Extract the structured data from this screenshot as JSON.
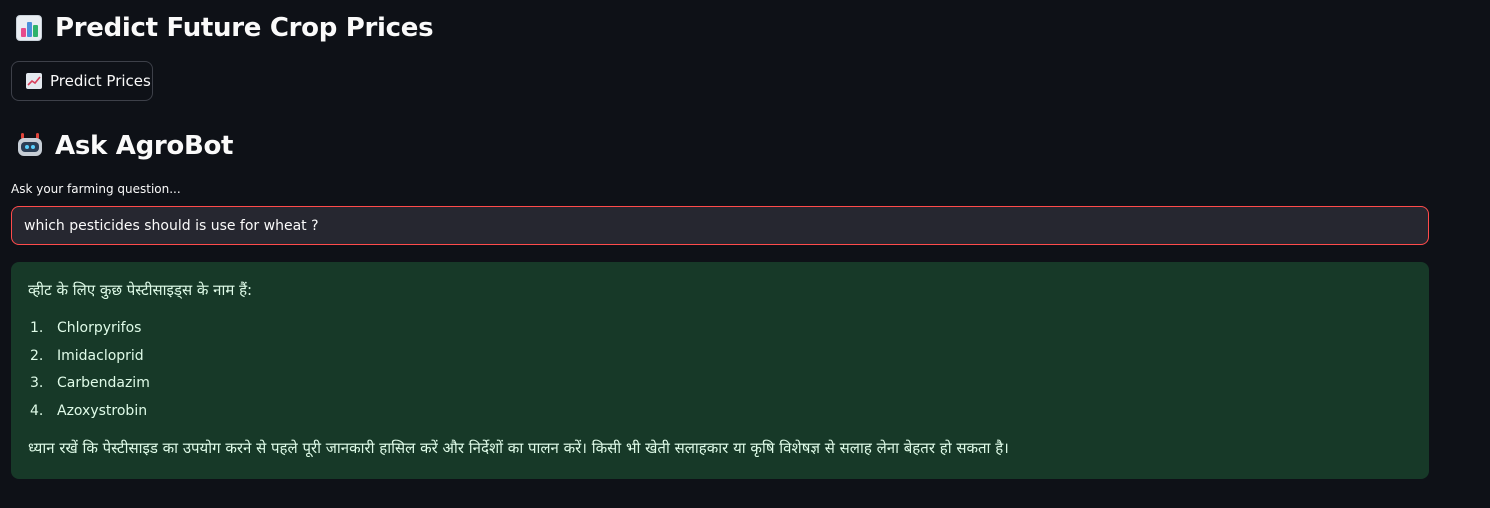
{
  "header": {
    "title": "Predict Future Crop Prices",
    "title_icon": "bar-chart-icon"
  },
  "actions": {
    "predict_button_label": "Predict Prices",
    "predict_button_icon": "chart-increasing-icon"
  },
  "chat": {
    "section_title": "Ask AgroBot",
    "section_icon": "robot-icon",
    "input_label": "Ask your farming question...",
    "input_value": "which pesticides should is use for wheat ?"
  },
  "answer": {
    "intro": "व्हीट के लिए कुछ पेस्टीसाइड्स के नाम हैं:",
    "items": [
      {
        "number": "1.",
        "label": "Chlorpyrifos"
      },
      {
        "number": "2.",
        "label": "Imidacloprid"
      },
      {
        "number": "3.",
        "label": "Carbendazim"
      },
      {
        "number": "4.",
        "label": "Azoxystrobin"
      }
    ],
    "outro": "ध्यान रखें कि पेस्टीसाइड का उपयोग करने से पहले पूरी जानकारी हासिल करें और निर्देशों का पालन करें। किसी भी खेती सलाहकार या कृषि विशेषज्ञ से सलाह लेना बेहतर हो सकता है।"
  },
  "colors": {
    "background": "#0e1117",
    "input_background": "#262730",
    "input_border_focus": "#ff4b4b",
    "success_background": "#173928",
    "success_text": "#dffbe8"
  }
}
